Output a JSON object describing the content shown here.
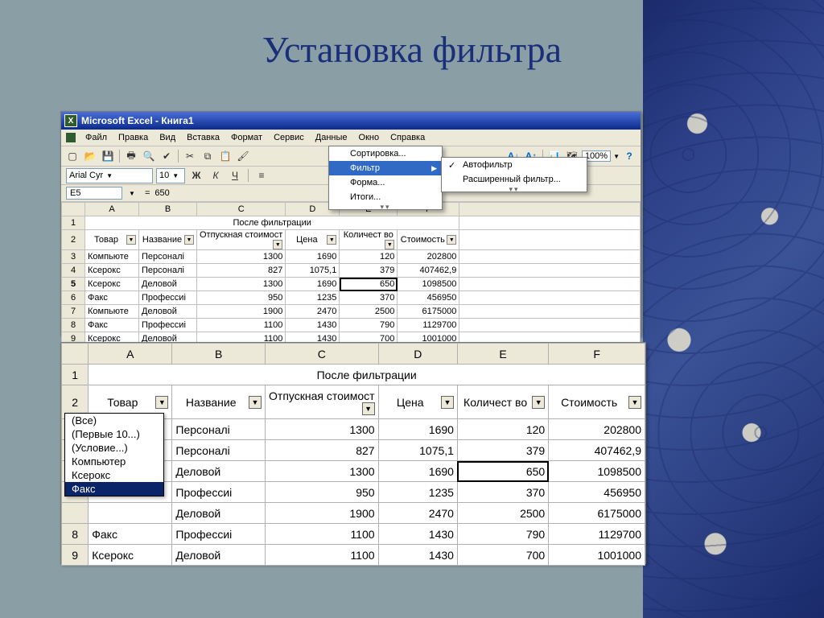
{
  "slide": {
    "title": "Установка фильтра"
  },
  "excel": {
    "title": "Microsoft Excel - Книга1",
    "menu": [
      "Файл",
      "Правка",
      "Вид",
      "Вставка",
      "Формат",
      "Сервис",
      "Данные",
      "Окно",
      "Справка"
    ],
    "font_name": "Arial Cyr",
    "font_size": "10",
    "active_cell": "E5",
    "formula_value": "650",
    "zoom": "100%",
    "data_menu": {
      "items": [
        "Сортировка...",
        "Фильтр",
        "Форма...",
        "Итоги..."
      ],
      "highlighted": 1
    },
    "filter_submenu": {
      "items": [
        "Автофильтр",
        "Расширенный фильтр..."
      ],
      "checked": 0
    },
    "chart_data": {
      "type": "table",
      "title": "После фильтрации",
      "columns": [
        "Товар",
        "Название",
        "Отпускная стоимост",
        "Цена",
        "Количест во",
        "Стоимость"
      ],
      "col_letters": [
        "A",
        "B",
        "C",
        "D",
        "E",
        "F"
      ],
      "rows": [
        [
          "Компьюте",
          "Персоналі",
          "1300",
          "1690",
          "120",
          "202800"
        ],
        [
          "Ксерокс",
          "Персоналі",
          "827",
          "1075,1",
          "379",
          "407462,9"
        ],
        [
          "Ксерокс",
          "Деловой",
          "1300",
          "1690",
          "650",
          "1098500"
        ],
        [
          "Факс",
          "Профессиі",
          "950",
          "1235",
          "370",
          "456950"
        ],
        [
          "Компьюте",
          "Деловой",
          "1900",
          "2470",
          "2500",
          "6175000"
        ],
        [
          "Факс",
          "Профессиі",
          "1100",
          "1430",
          "790",
          "1129700"
        ],
        [
          "Ксерокс",
          "Деловой",
          "1100",
          "1430",
          "700",
          "1001000"
        ]
      ],
      "row_nums": [
        "3",
        "4",
        "5",
        "6",
        "7",
        "8",
        "9"
      ]
    },
    "filter_list": [
      "(Все)",
      "(Первые 10...)",
      "(Условие...)",
      "Компьютер",
      "Ксерокс",
      "Факс"
    ],
    "filter_list_selected": 5
  }
}
